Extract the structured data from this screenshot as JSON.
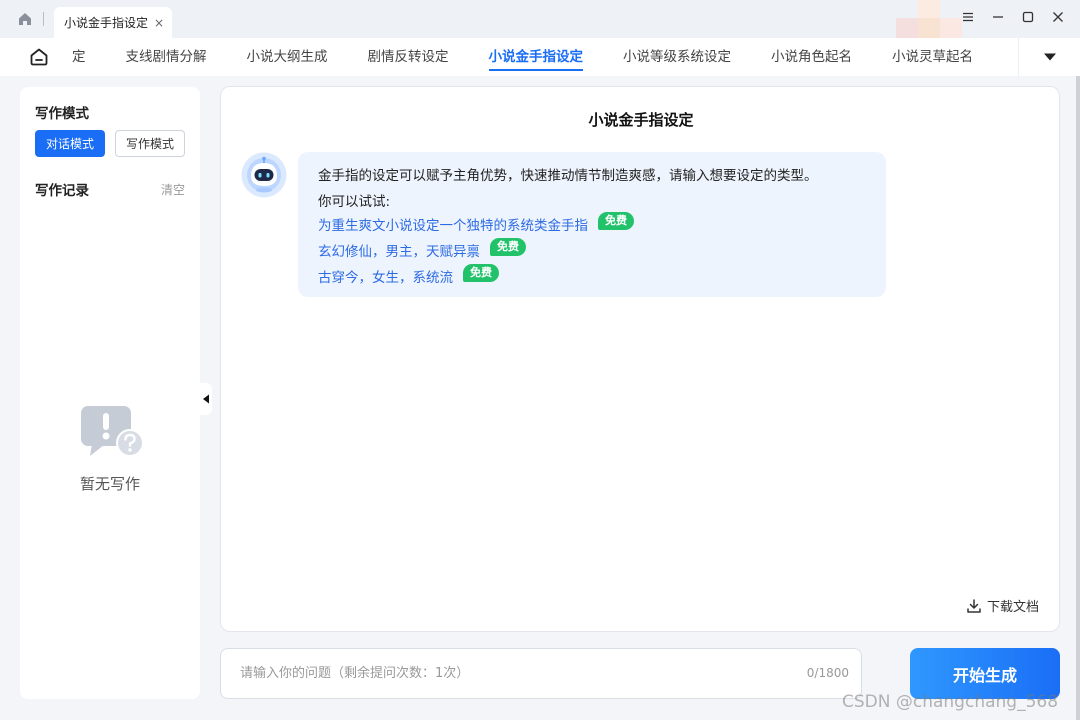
{
  "window": {
    "tab_title": "小说金手指设定",
    "tab_close": "×"
  },
  "nav": {
    "items": [
      {
        "label": "定"
      },
      {
        "label": "支线剧情分解"
      },
      {
        "label": "小说大纲生成"
      },
      {
        "label": "剧情反转设定"
      },
      {
        "label": "小说金手指设定",
        "active": true
      },
      {
        "label": "小说等级系统设定"
      },
      {
        "label": "小说角色起名"
      },
      {
        "label": "小说灵草起名"
      }
    ]
  },
  "sidebar": {
    "mode_title": "写作模式",
    "mode_chat": "对话模式",
    "mode_write": "写作模式",
    "record_title": "写作记录",
    "clear": "清空",
    "empty_text": "暂无写作"
  },
  "main": {
    "title": "小说金手指设定",
    "intro": "金手指的设定可以赋予主角优势，快速推动情节制造爽感，请输入想要设定的类型。",
    "try_label": "你可以试试:",
    "suggestions": [
      {
        "text": "为重生爽文小说设定一个独特的系统类金手指",
        "tag": "免费"
      },
      {
        "text": "玄幻修仙，男主，天赋异禀",
        "tag": "免费"
      },
      {
        "text": "古穿今，女生，系统流",
        "tag": "免费"
      }
    ],
    "download": "下载文档"
  },
  "input": {
    "placeholder": "请输入你的问题（剩余提问次数：1次）",
    "value": "",
    "counter": "0/1800"
  },
  "generate_button": "开始生成",
  "watermark": "CSDN @changchang_568",
  "colors": {
    "accent": "#1a6ef5",
    "free_tag": "#22c26b",
    "bubble_bg": "#eef4fd",
    "link": "#2d6be3"
  }
}
